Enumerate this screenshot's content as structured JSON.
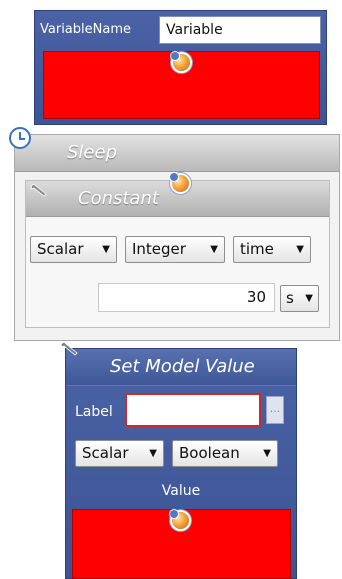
{
  "variable_block": {
    "name_label": "VariableName",
    "name_value": "Variable"
  },
  "sleep_block": {
    "title": "Sleep",
    "constant": {
      "title": "Constant",
      "scalar_dropdown": "Scalar",
      "type_dropdown": "Integer",
      "unit_kind_dropdown": "time",
      "value": "30",
      "unit_dropdown": "s"
    }
  },
  "set_model_value_block": {
    "title": "Set Model Value",
    "label_caption": "Label",
    "label_value": "",
    "ellipsis": "...",
    "scalar_dropdown": "Scalar",
    "type_dropdown": "Boolean",
    "value_caption": "Value"
  },
  "icons": {
    "dropdown_arrow": "▼",
    "connector": "plug-icon",
    "clock": "clock-icon",
    "wrench": "wrench-icon"
  },
  "colors": {
    "block_blue": "#3d5596",
    "error_red": "#ff0000",
    "header_gray": "#b9b9b9"
  }
}
